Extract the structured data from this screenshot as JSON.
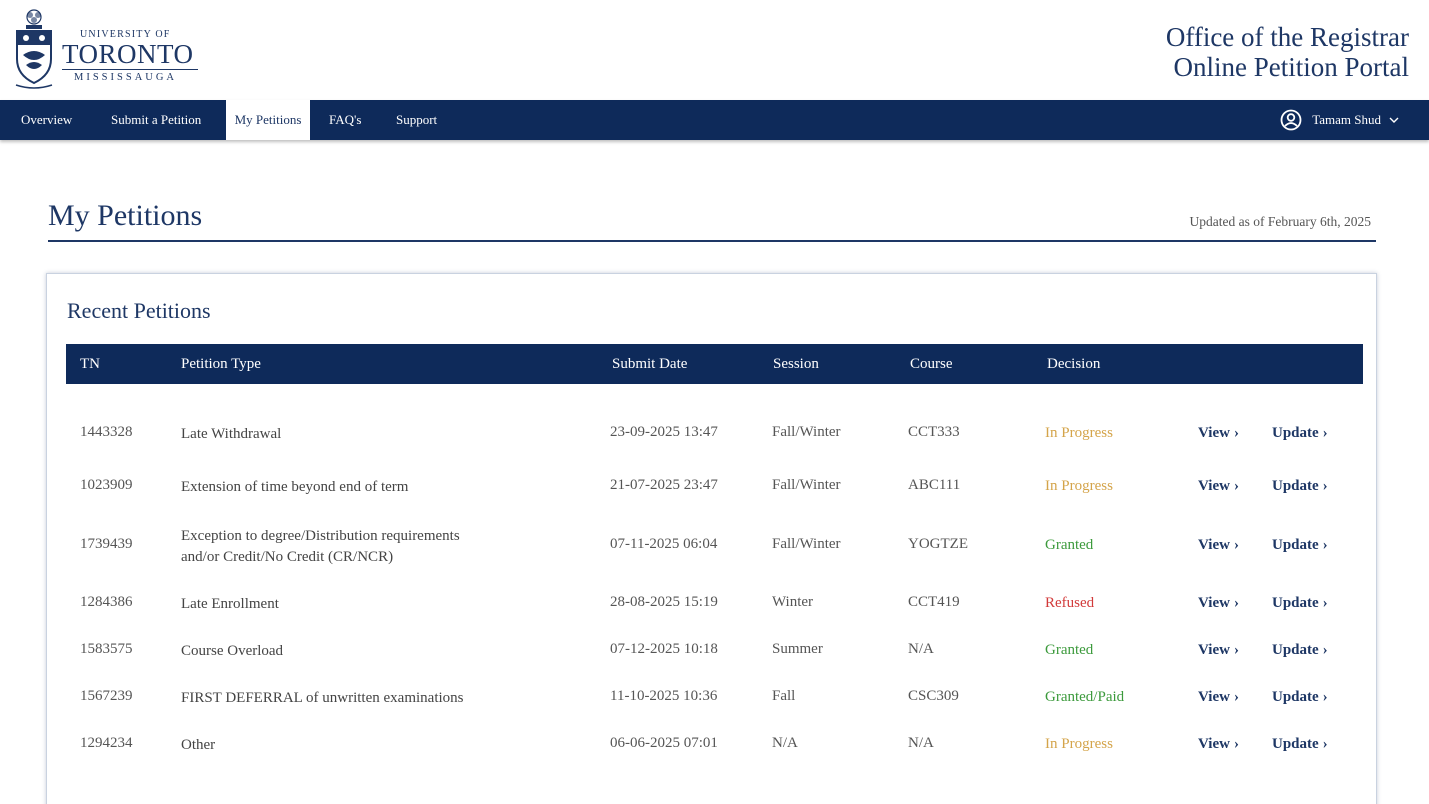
{
  "logo": {
    "line1": "UNIVERSITY OF",
    "line2": "TORONTO",
    "line3": "MISSISSAUGA"
  },
  "portal": {
    "title1": "Office of the Registrar",
    "title2": "Online Petition Portal"
  },
  "nav": {
    "items": [
      "Overview",
      "Submit a Petition",
      "My Petitions",
      "FAQ's",
      "Support"
    ],
    "active": "My Petitions",
    "user_name": "Tamam Shud",
    "user_icon": "user-circle-icon"
  },
  "page": {
    "title": "My Petitions",
    "updated": "Updated as of February 6th, 2025"
  },
  "recent": {
    "title": "Recent Petitions",
    "columns": [
      "TN",
      "Petition Type",
      "Submit Date",
      "Session",
      "Course",
      "Decision"
    ],
    "view_label": "View",
    "update_label": "Update",
    "rows": [
      {
        "tn": "1443328",
        "type": "Late Withdrawal",
        "type2": "",
        "date": "23-09-2025 13:47",
        "session": "Fall/Winter",
        "course": "CCT333",
        "decision": "In Progress",
        "decision_color": "#d4a44a"
      },
      {
        "tn": "1023909",
        "type": "Extension of time beyond end of term",
        "type2": "",
        "date": "21-07-2025 23:47",
        "session": "Fall/Winter",
        "course": "ABC111",
        "decision": "In Progress",
        "decision_color": "#d4a44a"
      },
      {
        "tn": "1739439",
        "type": "Exception to degree/Distribution requirements",
        "type2": "and/or Credit/No Credit (CR/NCR)",
        "date": "07-11-2025 06:04",
        "session": "Fall/Winter",
        "course": "YOGTZE",
        "decision": "Granted",
        "decision_color": "#3c9a3c"
      },
      {
        "tn": "1284386",
        "type": "Late Enrollment",
        "type2": "",
        "date": "28-08-2025 15:19",
        "session": "Winter",
        "course": "CCT419",
        "decision": "Refused",
        "decision_color": "#d23a3a"
      },
      {
        "tn": "1583575",
        "type": "Course Overload",
        "type2": "",
        "date": "07-12-2025 10:18",
        "session": "Summer",
        "course": "N/A",
        "decision": "Granted",
        "decision_color": "#3c9a3c"
      },
      {
        "tn": "1567239",
        "type": "FIRST DEFERRAL of unwritten examinations",
        "type2": "",
        "date": "11-10-2025 10:36",
        "session": "Fall",
        "course": "CSC309",
        "decision": "Granted/Paid",
        "decision_color": "#3c9a3c"
      },
      {
        "tn": "1294234",
        "type": "Other",
        "type2": "",
        "date": "06-06-2025 07:01",
        "session": "N/A",
        "course": "N/A",
        "decision": "In Progress",
        "decision_color": "#d4a44a"
      }
    ]
  },
  "colors": {
    "navy": "#0e2a5a",
    "brand": "#1e3765"
  }
}
